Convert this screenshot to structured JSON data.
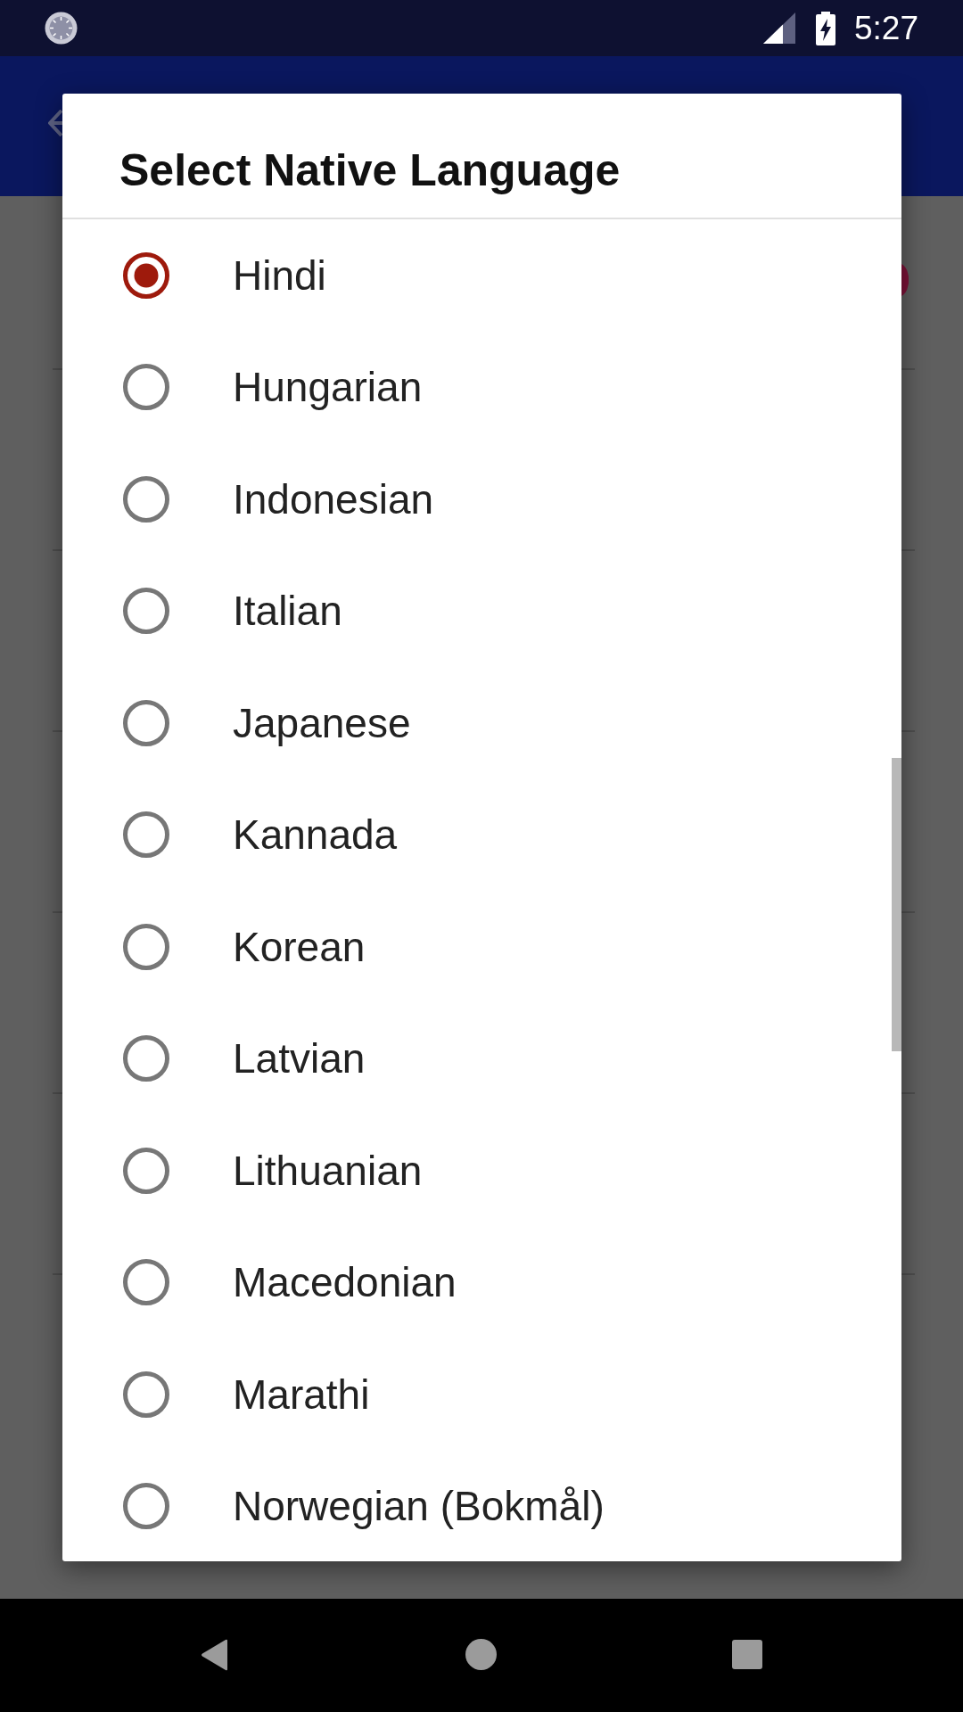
{
  "status_bar": {
    "time": "5:27"
  },
  "dialog": {
    "title": "Select Native Language",
    "options": [
      {
        "label": "Hindi",
        "selected": true
      },
      {
        "label": "Hungarian",
        "selected": false
      },
      {
        "label": "Indonesian",
        "selected": false
      },
      {
        "label": "Italian",
        "selected": false
      },
      {
        "label": "Japanese",
        "selected": false
      },
      {
        "label": "Kannada",
        "selected": false
      },
      {
        "label": "Korean",
        "selected": false
      },
      {
        "label": "Latvian",
        "selected": false
      },
      {
        "label": "Lithuanian",
        "selected": false
      },
      {
        "label": "Macedonian",
        "selected": false
      },
      {
        "label": "Marathi",
        "selected": false
      },
      {
        "label": "Norwegian (Bokmål)",
        "selected": false
      }
    ]
  }
}
